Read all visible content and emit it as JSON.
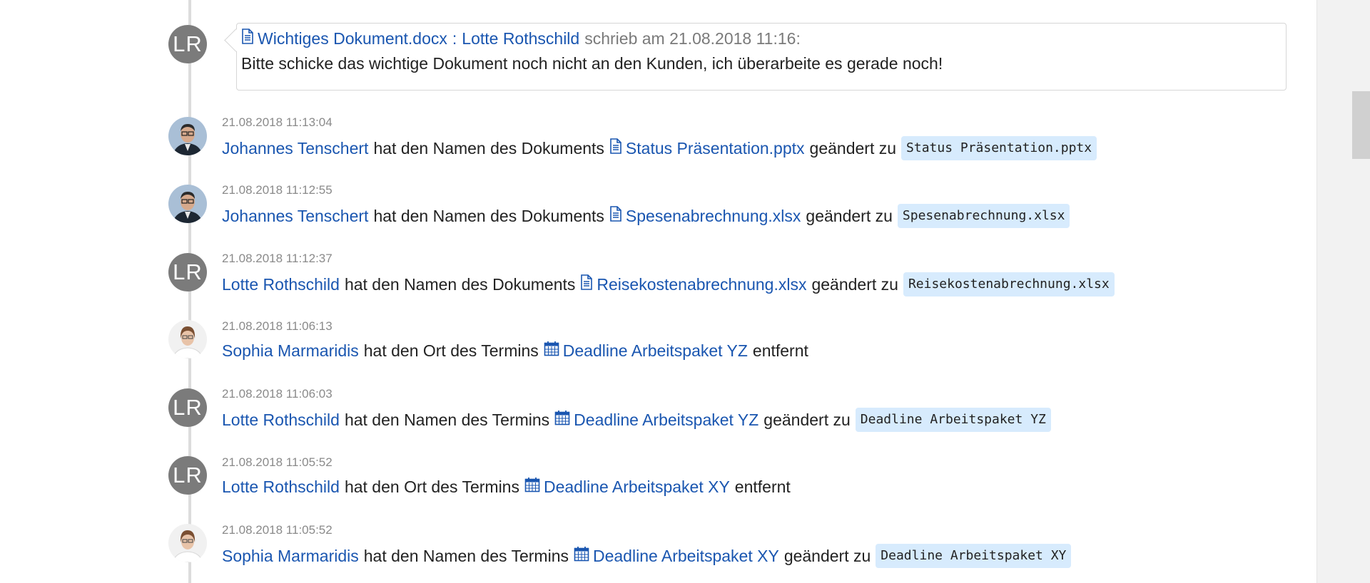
{
  "comment": {
    "avatar_initials": "LR",
    "doc_name": "Wichtiges Dokument.docx",
    "separator": ":",
    "author": "Lotte Rothschild",
    "suffix": "schrieb am 21.08.2018 11:16:",
    "body": "Bitte schicke das wichtige Dokument noch nicht an den Kunden, ich überarbeite es gerade noch!"
  },
  "entries": [
    {
      "timestamp": "21.08.2018 11:13:04",
      "user": "Johannes Tenschert",
      "avatar": "photo-man",
      "action": "hat den Namen des Dokuments",
      "item_icon": "document-icon",
      "item": "Status Präsentation.pptx",
      "verb": "geändert zu",
      "new_value": "Status Präsentation.pptx"
    },
    {
      "timestamp": "21.08.2018 11:12:55",
      "user": "Johannes Tenschert",
      "avatar": "photo-man",
      "action": "hat den Namen des Dokuments",
      "item_icon": "document-icon",
      "item": "Spesenabrechnung.xlsx",
      "verb": "geändert zu",
      "new_value": "Spesenabrechnung.xlsx"
    },
    {
      "timestamp": "21.08.2018 11:12:37",
      "user": "Lotte Rothschild",
      "avatar": "LR",
      "action": "hat den Namen des Dokuments",
      "item_icon": "document-icon",
      "item": "Reisekostenabrechnung.xlsx",
      "verb": "geändert zu",
      "new_value": "Reisekostenabrechnung.xlsx"
    },
    {
      "timestamp": "21.08.2018 11:06:13",
      "user": "Sophia Marmaridis",
      "avatar": "photo-woman",
      "action": "hat den Ort des Termins",
      "item_icon": "calendar-icon",
      "item": "Deadline Arbeitspaket YZ",
      "verb": "entfernt",
      "new_value": ""
    },
    {
      "timestamp": "21.08.2018 11:06:03",
      "user": "Lotte Rothschild",
      "avatar": "LR",
      "action": "hat den Namen des Termins",
      "item_icon": "calendar-icon",
      "item": "Deadline Arbeitspaket YZ",
      "verb": "geändert zu",
      "new_value": "Deadline Arbeitspaket YZ"
    },
    {
      "timestamp": "21.08.2018 11:05:52",
      "user": "Lotte Rothschild",
      "avatar": "LR",
      "action": "hat den Ort des Termins",
      "item_icon": "calendar-icon",
      "item": "Deadline Arbeitspaket XY",
      "verb": "entfernt",
      "new_value": ""
    },
    {
      "timestamp": "21.08.2018 11:05:52",
      "user": "Sophia Marmaridis",
      "avatar": "photo-woman",
      "action": "hat den Namen des Termins",
      "item_icon": "calendar-icon",
      "item": "Deadline Arbeitspaket XY",
      "verb": "geändert zu",
      "new_value": "Deadline Arbeitspaket XY"
    }
  ],
  "colors": {
    "link": "#1a56b0",
    "code_bg": "#d7ebfd",
    "avatar_gray": "#7b7b7b",
    "timestamp": "#8a8a8a"
  }
}
